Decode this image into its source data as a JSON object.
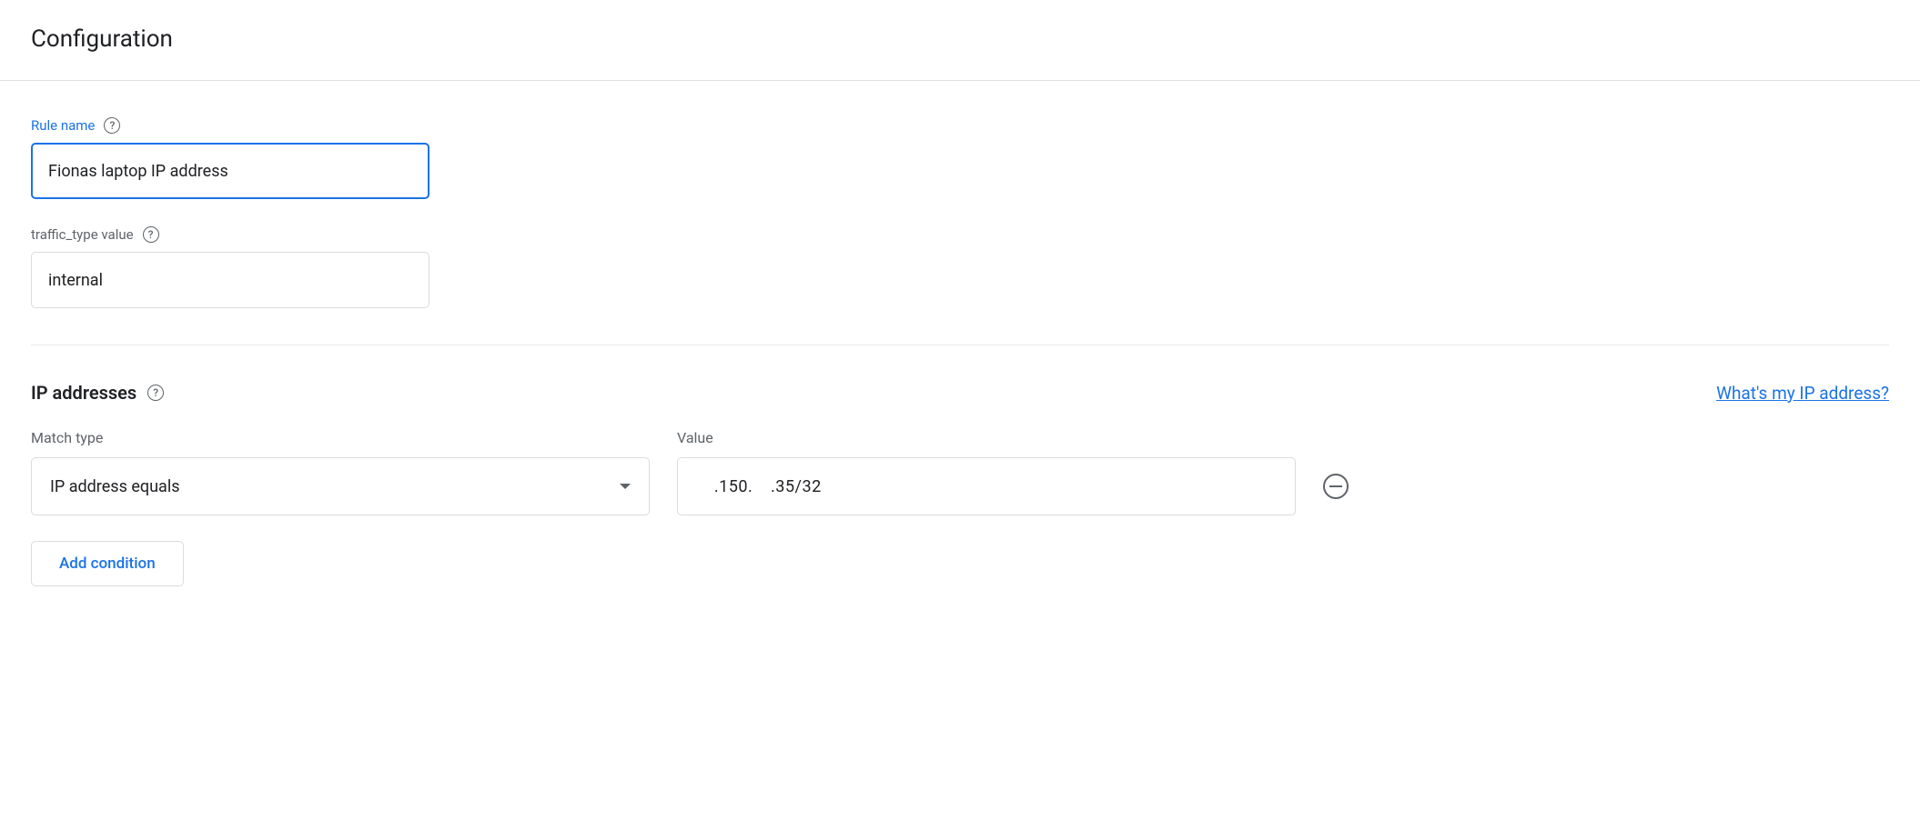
{
  "page_title": "Configuration",
  "rule_name": {
    "label": "Rule name",
    "value": "Fionas laptop IP address"
  },
  "traffic_type": {
    "label": "traffic_type value",
    "value": "internal"
  },
  "ip_section": {
    "title": "IP addresses",
    "help_link": "What's my IP address?",
    "columns": {
      "match": "Match type",
      "value": "Value"
    },
    "conditions": [
      {
        "match_type": "IP address equals",
        "value": "    .150.    .35/32"
      }
    ],
    "add_button": "Add condition"
  }
}
